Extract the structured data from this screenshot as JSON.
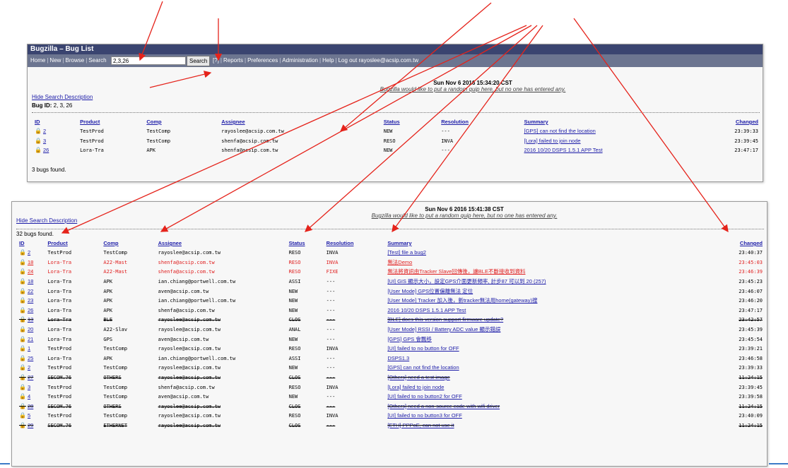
{
  "panel1": {
    "title": "Bugzilla – Bug List",
    "nav": [
      "Home",
      "New",
      "Browse",
      "Search"
    ],
    "search_value": "2,3,26",
    "search_button": "Search",
    "help": "[?]",
    "nav_rest": [
      "Reports",
      "Preferences",
      "Administration",
      "Help",
      "Log out rayoslee@acsip.com.tw"
    ],
    "date": "Sun Nov 6 2016 15:34:20 CST",
    "quip": "Bugzilla would like to put a random quip here, but no one has entered any.",
    "hide_search": "Hide Search Description",
    "bug_id_label": "Bug ID:",
    "bug_id_value": "2, 3, 26",
    "headers": [
      "ID",
      "Product",
      "Comp",
      "Assignee",
      "Status",
      "Resolution",
      "Summary",
      "Changed"
    ],
    "rows": [
      {
        "id": "2",
        "product": "TestProd",
        "comp": "TestComp",
        "assignee": "rayoslee@acsip.com.tw",
        "status": "NEW",
        "resolution": "---",
        "summary": "[GPS] can not find the location",
        "changed": "23:39:33"
      },
      {
        "id": "3",
        "product": "TestProd",
        "comp": "TestComp",
        "assignee": "shenfa@acsip.com.tw",
        "status": "RESO",
        "resolution": "INVA",
        "summary": "[Lora] failed to join node",
        "changed": "23:39:45"
      },
      {
        "id": "26",
        "product": "Lora-Tra",
        "comp": "APK",
        "assignee": "shenfa@acsip.com.tw",
        "status": "NEW",
        "resolution": "---",
        "summary": "2016 10/20 DSPS 1.5.1 APP Test",
        "changed": "23:47:17"
      }
    ],
    "count": "3 bugs found."
  },
  "panel2": {
    "date": "Sun Nov 6 2016 15:41:38 CST",
    "quip": "Bugzilla would like to put a random quip here, but no one has entered any.",
    "hide_search": "Hide Search Description",
    "count": "32 bugs found.",
    "headers": [
      "ID",
      "Product",
      "Comp",
      "Assignee",
      "Status",
      "Resolution",
      "Summary",
      "Changed"
    ],
    "rows": [
      {
        "id": "2",
        "product": "TestProd",
        "comp": "TestComp",
        "assignee": "rayoslee@acsip.com.tw",
        "status": "RESO",
        "resolution": "INVA",
        "summary": "[Test] file a bug2",
        "changed": "23:40:37",
        "style": ""
      },
      {
        "id": "18",
        "product": "Lora-Tra",
        "comp": "A22-Mast",
        "assignee": "shenfa@acsip.com.tw",
        "status": "RESO",
        "resolution": "INVA",
        "summary": "無法Demo",
        "changed": "23:45:03",
        "style": "red"
      },
      {
        "id": "24",
        "product": "Lora-Tra",
        "comp": "A22-Mast",
        "assignee": "shenfa@acsip.com.tw",
        "status": "RESO",
        "resolution": "FIXE",
        "summary": "無法將資訊由Tracker Slave回傳後，讓BLE不斷接收到資料",
        "changed": "23:46:39",
        "style": "red"
      },
      {
        "id": "18",
        "product": "Lora-Tra",
        "comp": "APK",
        "assignee": "ian.chiang@portwell.com.tw",
        "status": "ASSI",
        "resolution": "---",
        "summary": "[UI] GIS 顯示大小，設定GPS介面更新頻率, 計步87 可以到 20 (257)",
        "changed": "23:45:23",
        "style": ""
      },
      {
        "id": "22",
        "product": "Lora-Tra",
        "comp": "APK",
        "assignee": "aven@acsip.com.tw",
        "status": "NEW",
        "resolution": "---",
        "summary": "[User Mode] GPS位置偏離無法 定位",
        "changed": "23:46:07",
        "style": ""
      },
      {
        "id": "23",
        "product": "Lora-Tra",
        "comp": "APK",
        "assignee": "ian.chiang@portwell.com.tw",
        "status": "NEW",
        "resolution": "---",
        "summary": "[User Mode] Tracker 加入後，新tracker無法用home(gateway)搜",
        "changed": "23:46:20",
        "style": ""
      },
      {
        "id": "26",
        "product": "Lora-Tra",
        "comp": "APK",
        "assignee": "shenfa@acsip.com.tw",
        "status": "NEW",
        "resolution": "---",
        "summary": "2016 10/20 DSPS 1.5.1 APP Test",
        "changed": "23:47:17",
        "style": ""
      },
      {
        "id": "13",
        "product": "Lora-Tra",
        "comp": "BLE",
        "assignee": "rayoslee@acsip.com.tw",
        "status": "CLOS",
        "resolution": "---",
        "summary": "[BLE] does this version support firmware update?",
        "changed": "23:42:57",
        "style": "strike"
      },
      {
        "id": "20",
        "product": "Lora-Tra",
        "comp": "A22-Slav",
        "assignee": "rayoslee@acsip.com.tw",
        "status": "ANAL",
        "resolution": "---",
        "summary": "[User Mode] RSSI / Battery ADC value 顯示錯誤",
        "changed": "23:45:39",
        "style": ""
      },
      {
        "id": "21",
        "product": "Lora-Tra",
        "comp": "GPS",
        "assignee": "aven@acsip.com.tw",
        "status": "NEW",
        "resolution": "---",
        "summary": "[GPS] GPS 會飄移",
        "changed": "23:45:54",
        "style": ""
      },
      {
        "id": "1",
        "product": "TestProd",
        "comp": "TestComp",
        "assignee": "rayoslee@acsip.com.tw",
        "status": "RESO",
        "resolution": "INVA",
        "summary": "[UI] failed to no button for OFF",
        "changed": "23:39:21",
        "style": ""
      },
      {
        "id": "25",
        "product": "Lora-Tra",
        "comp": "APK",
        "assignee": "ian.chiang@portwell.com.tw",
        "status": "ASSI",
        "resolution": "---",
        "summary": "DSPS1.3",
        "changed": "23:46:58",
        "style": ""
      },
      {
        "id": "2",
        "product": "TestProd",
        "comp": "TestComp",
        "assignee": "rayoslee@acsip.com.tw",
        "status": "NEW",
        "resolution": "---",
        "summary": "[GPS] can not find the location",
        "changed": "23:39:33",
        "style": ""
      },
      {
        "id": "27",
        "product": "SECOM.76",
        "comp": "OTHERS",
        "assignee": "rayoslee@acsip.com.tw",
        "status": "CLOS",
        "resolution": "---",
        "summary": "[Others] need a test image",
        "changed": "11:24:15",
        "style": "strike"
      },
      {
        "id": "3",
        "product": "TestProd",
        "comp": "TestComp",
        "assignee": "shenfa@acsip.com.tw",
        "status": "RESO",
        "resolution": "INVA",
        "summary": "[Lora] failed to join node",
        "changed": "23:39:45",
        "style": ""
      },
      {
        "id": "4",
        "product": "TestProd",
        "comp": "TestComp",
        "assignee": "aven@acsip.com.tw",
        "status": "NEW",
        "resolution": "---",
        "summary": "[UI] failed to no button2 for OFF",
        "changed": "23:39:58",
        "style": ""
      },
      {
        "id": "28",
        "product": "SECOM.76",
        "comp": "OTHERS",
        "assignee": "rayoslee@acsip.com.tw",
        "status": "CLOS",
        "resolution": "---",
        "summary": "[Others] need a non-source code with wifi driver",
        "changed": "11:24:15",
        "style": "strike"
      },
      {
        "id": "5",
        "product": "TestProd",
        "comp": "TestComp",
        "assignee": "rayoslee@acsip.com.tw",
        "status": "RESO",
        "resolution": "INVA",
        "summary": "[UI] failed to no button3 for OFF",
        "changed": "23:40:09",
        "style": ""
      },
      {
        "id": "29",
        "product": "SECOM.76",
        "comp": "ETHERNET",
        "assignee": "rayoslee@acsip.com.tw",
        "status": "CLOS",
        "resolution": "---",
        "summary": "[ETH] PPPoE, can not use it",
        "changed": "11:24:15",
        "style": "strike"
      }
    ]
  }
}
